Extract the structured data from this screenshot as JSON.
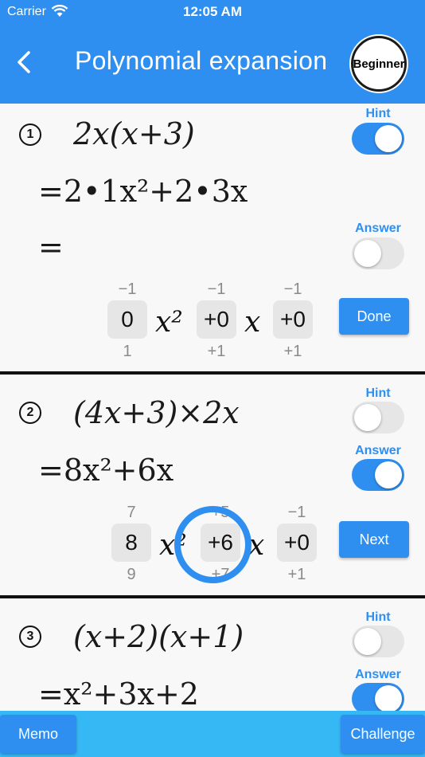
{
  "status": {
    "carrier": "Carrier",
    "time": "12:05 AM"
  },
  "header": {
    "title": "Polynomial expansion",
    "level": "Beginner"
  },
  "problems": [
    {
      "number": "1",
      "expression": "2x(x+3)",
      "step": "=2•1x²+2•3x",
      "answer_prefix": "=",
      "hint_label": "Hint",
      "answer_label": "Answer",
      "hint_on": true,
      "answer_on": false,
      "pickers": [
        {
          "above": "−1",
          "value": "0",
          "below": "1"
        },
        {
          "above": "−1",
          "value": "+0",
          "below": "+1"
        },
        {
          "above": "−1",
          "value": "+0",
          "below": "+1"
        }
      ],
      "var1": "x²",
      "var2": "x",
      "button": "Done"
    },
    {
      "number": "2",
      "expression": "(4x+3)×2x",
      "answer_line": "=8x²+6x",
      "hint_label": "Hint",
      "answer_label": "Answer",
      "hint_on": false,
      "answer_on": true,
      "pickers": [
        {
          "above": "7",
          "value": "8",
          "below": "9"
        },
        {
          "above": "+5",
          "value": "+6",
          "below": "+7"
        },
        {
          "above": "−1",
          "value": "+0",
          "below": "+1"
        }
      ],
      "var1": "x²",
      "var2": "x",
      "button": "Next"
    },
    {
      "number": "3",
      "expression": "(x+2)(x+1)",
      "answer_line": "=x²+3x+2",
      "hint_label": "Hint",
      "answer_label": "Answer",
      "hint_on": false,
      "answer_on": true
    }
  ],
  "footer": {
    "memo": "Memo",
    "challenge": "Challenge"
  },
  "colors": {
    "primary": "#2f8ff0",
    "bottom_bar": "#36b8f5",
    "toggle_off": "#e6e6e6"
  }
}
